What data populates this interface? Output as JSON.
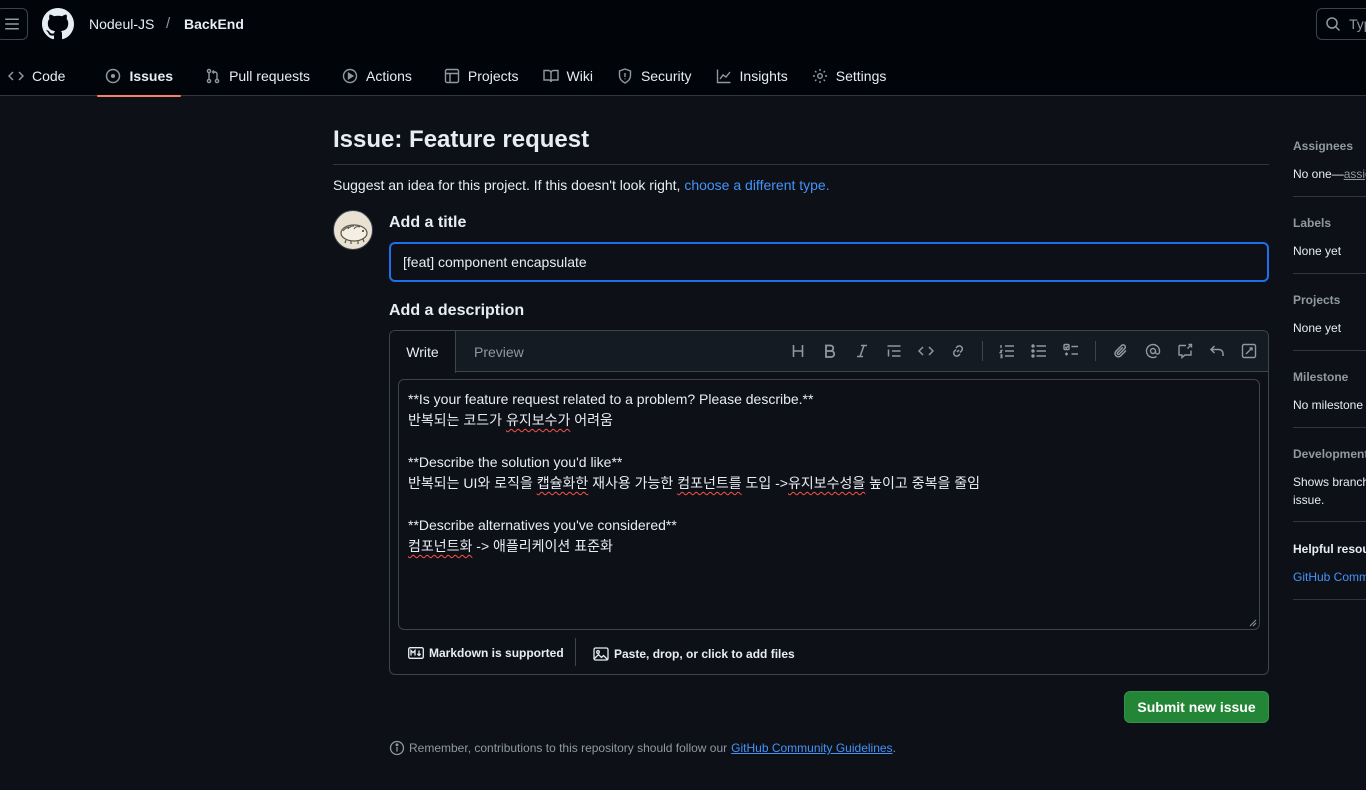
{
  "header": {
    "owner": "Nodeul-JS",
    "separator": "/",
    "repo": "BackEnd",
    "search_placeholder": "Typ",
    "icons": [
      "hamburger-icon",
      "github-logo-icon",
      "search-icon"
    ]
  },
  "repo_nav": {
    "tabs": [
      {
        "label": "Code",
        "icon": "code-icon",
        "active": false
      },
      {
        "label": "Issues",
        "icon": "issue-opened-icon",
        "active": true
      },
      {
        "label": "Pull requests",
        "icon": "git-pull-request-icon",
        "active": false
      },
      {
        "label": "Actions",
        "icon": "play-icon",
        "active": false
      },
      {
        "label": "Projects",
        "icon": "table-icon",
        "active": false
      },
      {
        "label": "Wiki",
        "icon": "book-icon",
        "active": false
      },
      {
        "label": "Security",
        "icon": "shield-icon",
        "active": false
      },
      {
        "label": "Insights",
        "icon": "graph-icon",
        "active": false
      },
      {
        "label": "Settings",
        "icon": "gear-icon",
        "active": false
      }
    ],
    "active_color": "#f78166"
  },
  "form": {
    "page_title": "Issue: Feature request",
    "subtitle_prefix": "Suggest an idea for this project. If this doesn't look right,",
    "subtitle_link": "choose a different type.",
    "title_label": "Add a title",
    "title_value": "[feat] component encapsulate",
    "description_label": "Add a description",
    "editor_tabs": {
      "write": "Write",
      "preview": "Preview"
    },
    "toolbar_icons": [
      "heading-icon",
      "bold-icon",
      "italic-icon",
      "quote-icon",
      "code-icon",
      "link-icon",
      "ordered-list-icon",
      "unordered-list-icon",
      "task-list-icon",
      "attach-icon",
      "mention-icon",
      "reference-icon",
      "undo-icon",
      "fullscreen-icon"
    ],
    "body_lines": [
      "**Is your feature request related to a problem? Please describe.**",
      "반복되는 코드가 유지보수가 어려움",
      "",
      "**Describe the solution you'd like**",
      "반복되는 UI와 로직을 캡슐화한 재사용 가능한 컴포넌트를 도입 ->유지보수성을 높이고 중복을 줄임",
      "",
      "**Describe alternatives you've considered**",
      "컴포넌트화 -> 애플리케이션 표준화"
    ],
    "markdown_note": "Markdown is supported",
    "attach_note": "Paste, drop, or click to add files",
    "submit_label": "Submit new issue",
    "reminder_prefix": "Remember, contributions to this repository should follow our",
    "reminder_link": "GitHub Community Guidelines",
    "reminder_suffix": ".",
    "submit_color": "#238636",
    "link_color": "#4493f8"
  },
  "sidebar": {
    "assignees": {
      "label": "Assignees",
      "value": "No one—",
      "link": "assign"
    },
    "labels": {
      "label": "Labels",
      "value": "None yet"
    },
    "projects": {
      "label": "Projects",
      "value": "None yet"
    },
    "milestone": {
      "label": "Milestone",
      "value": "No milestone"
    },
    "development": {
      "label": "Development",
      "value_line1": "Shows branch",
      "value_line2": "issue."
    },
    "helpful": {
      "label": "Helpful resou",
      "link": "GitHub Comm"
    }
  }
}
